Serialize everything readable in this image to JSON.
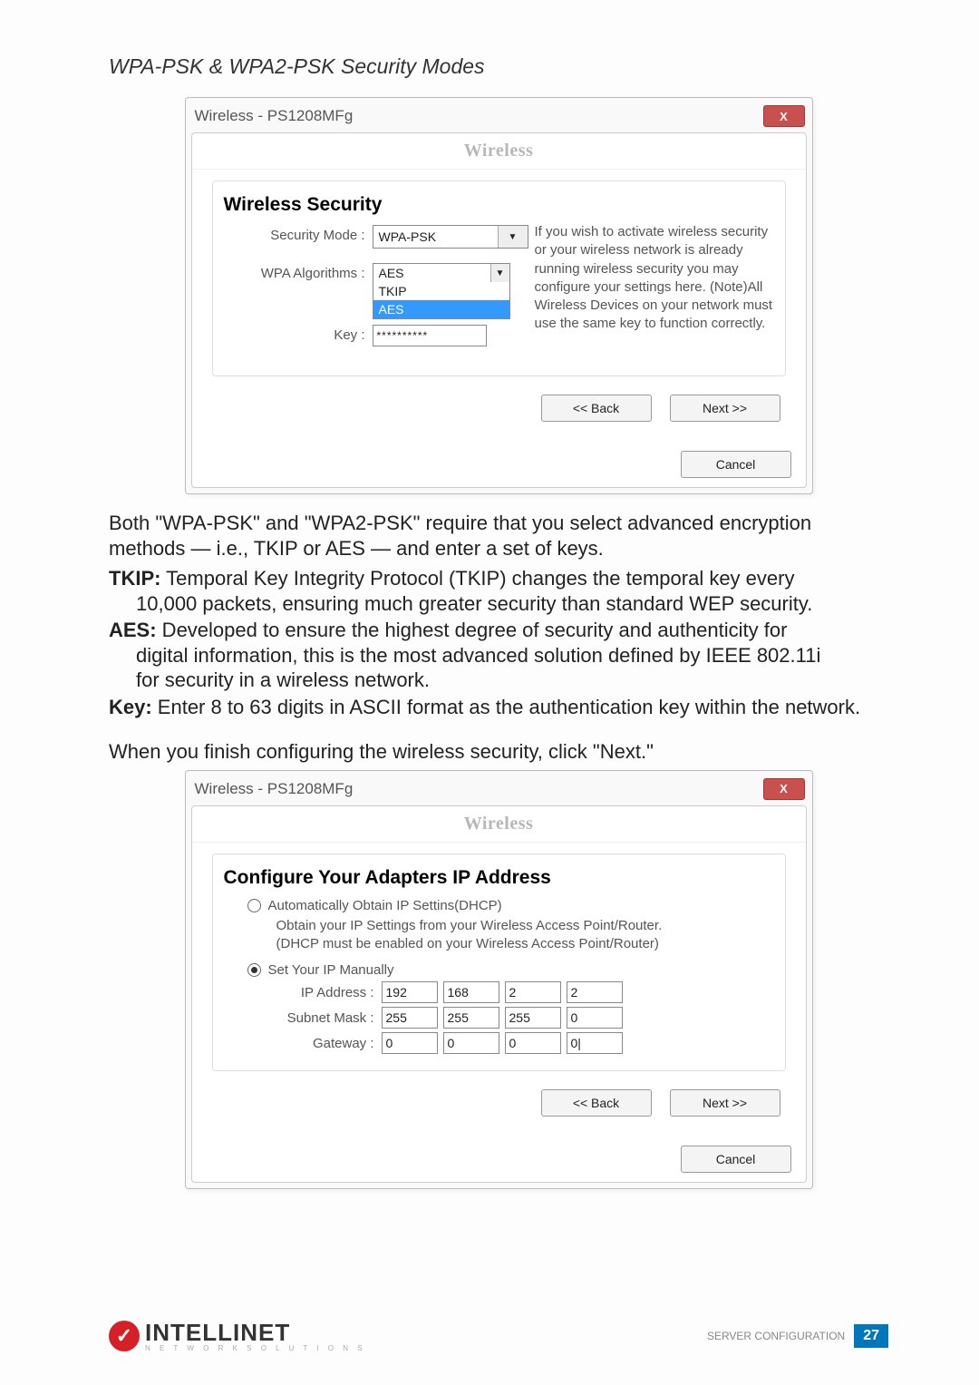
{
  "section_title": "WPA-PSK & WPA2-PSK Security Modes",
  "dialog1": {
    "title": "Wireless - PS1208MFg",
    "banner": "Wireless",
    "heading": "Wireless Security",
    "security_mode_label": "Security Mode :",
    "security_mode_value": "WPA-PSK",
    "algo_label": "WPA Algorithms :",
    "algo_options": [
      "AES",
      "TKIP",
      "AES"
    ],
    "key_label": "Key :",
    "key_value": "**********",
    "help": "If you wish to activate wireless security or your wireless network is already running wireless security you may configure your settings here. (Note)All Wireless Devices on your network must use the same key to function correctly.",
    "back": "<< Back",
    "next": "Next >>",
    "cancel": "Cancel"
  },
  "para_intro": "Both \"WPA-PSK\" and \"WPA2-PSK\" require that you select advanced encryption methods — i.e., TKIP or AES — and enter a set of keys.",
  "tkip_label": "TKIP:",
  "tkip_text_1": " Temporal Key Integrity Protocol (TKIP) changes the temporal key every",
  "tkip_text_2": "10,000 packets, ensuring much greater security than standard WEP security.",
  "aes_label": "AES:",
  "aes_text_1": "  Developed to ensure the highest degree of security and authenticity for",
  "aes_text_2": "digital information, this is the most advanced solution defined by IEEE 802.11i",
  "aes_text_3": "for security in a wireless network.",
  "key_def_label": "Key:",
  "key_def_text": " Enter 8 to 63 digits in ASCII format as the authentication key within the network.",
  "para_next": "When you finish configuring the wireless security, click \"Next.\"",
  "dialog2": {
    "title": "Wireless - PS1208MFg",
    "banner": "Wireless",
    "heading": "Configure Your Adapters IP Address",
    "radio_dhcp": "Automatically Obtain IP Settins(DHCP)",
    "dhcp_help_1": "Obtain your IP Settings from your Wireless Access Point/Router.",
    "dhcp_help_2": "(DHCP must be enabled on your Wireless Access Point/Router)",
    "radio_manual": "Set Your IP Manually",
    "ip_label": "IP Address :",
    "ip": [
      "192",
      "168",
      "2",
      "2"
    ],
    "mask_label": "Subnet Mask :",
    "mask": [
      "255",
      "255",
      "255",
      "0"
    ],
    "gw_label": "Gateway :",
    "gw": [
      "0",
      "0",
      "0",
      "0|"
    ],
    "back": "<< Back",
    "next": "Next >>",
    "cancel": "Cancel"
  },
  "footer": {
    "brand": "INTELLINET",
    "brand_sub": "N E T W O R K   S O L U T I O N S",
    "section": "SERVER CONFIGURATION",
    "page": "27"
  }
}
